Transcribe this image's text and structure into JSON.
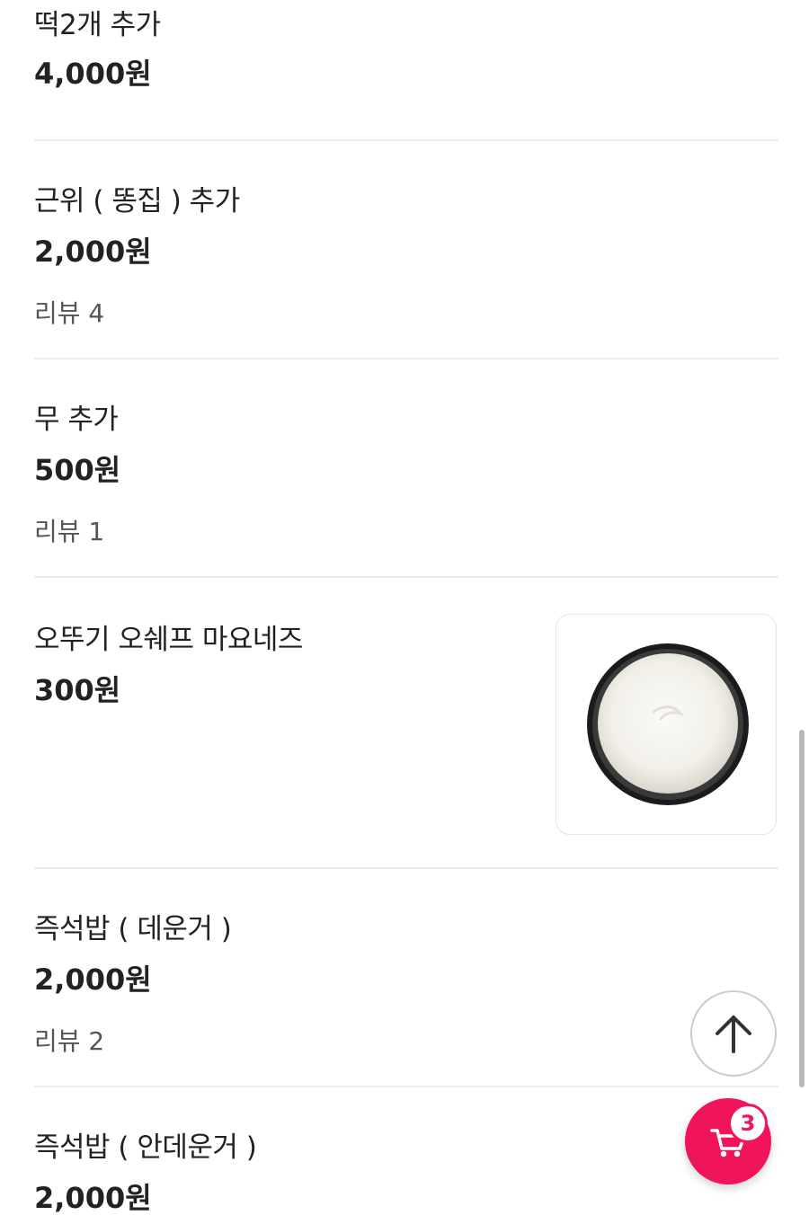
{
  "menu": {
    "items": [
      {
        "name": "떡2개 추가",
        "price": "4,000원",
        "review": ""
      },
      {
        "name": "근위 ( 똥집 )  추가",
        "price": "2,000원",
        "review": "리뷰 4"
      },
      {
        "name": "무 추가",
        "price": "500원",
        "review": "리뷰 1"
      },
      {
        "name": "오뚜기 오쉐프 마요네즈",
        "price": "300원",
        "review": "",
        "image": "mayonnaise-bowl"
      },
      {
        "name": "즉석밥 ( 데운거 )",
        "price": "2,000원",
        "review": "리뷰 2"
      },
      {
        "name": "즉석밥 ( 안데운거 )",
        "price": "2,000원",
        "review": ""
      }
    ]
  },
  "floating": {
    "top_button_icon": "arrow-up-icon",
    "cart_icon": "cart-icon",
    "cart_count": "3"
  },
  "colors": {
    "accent": "#f0145a",
    "text": "#222222",
    "muted": "#555555",
    "divider": "#ececec"
  }
}
